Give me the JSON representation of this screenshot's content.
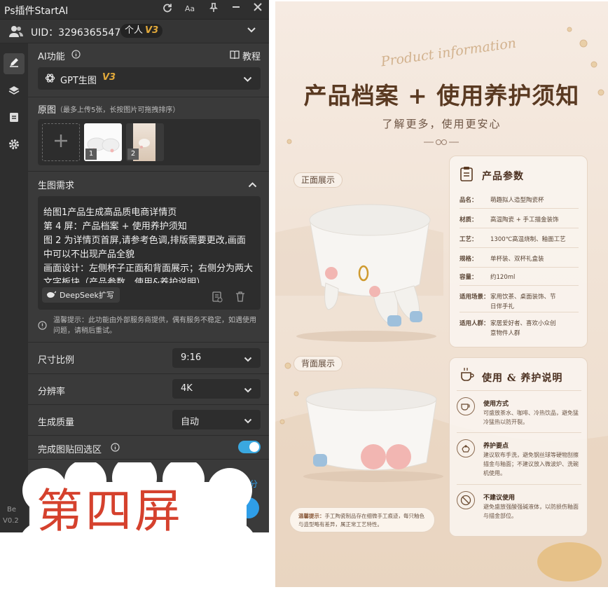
{
  "app": {
    "title": "Ps插件StartAI"
  },
  "titlebar": {
    "refresh_icon": "refresh-icon",
    "font_label": "Aa",
    "pin_icon": "pin-icon",
    "min_icon": "minimize-icon",
    "close_icon": "close-icon"
  },
  "user": {
    "uid_label": "UID：3296365547",
    "plan": "个人",
    "plan_tag": "V3"
  },
  "ai": {
    "label": "AI功能",
    "tutorial": "教程",
    "model": "GPT生图",
    "model_tag": "V3"
  },
  "source": {
    "label": "原图",
    "hint": "（最多上传5张，长按图片可拖拽排序）",
    "thumbs": [
      {
        "index": "1"
      },
      {
        "index": "2"
      }
    ]
  },
  "request": {
    "label": "生图需求",
    "text": "给图1产品生成高品质电商详情页\n第 4 屏：产品档案 + 使用养护须知\n图 2 为详情页首屏,请参考色调,排版需要更改,画面中可以不出现产品全貌\n画面设计：左侧杯子正面和背面展示；右侧分为两大文字板块（产品参数、使用&养护说明）",
    "deepseek": "DeepSeek扩写",
    "notice": "温馨提示：此功能由外部服务商提供，偶有服务不稳定，如遇使用问题，请稍后重试。"
  },
  "settings": {
    "ratio_label": "尺寸比例",
    "ratio_value": "9:16",
    "res_label": "分辨率",
    "res_value": "4K",
    "quality_label": "生成质量",
    "quality_value": "自动",
    "paste_label": "完成图贴回选区",
    "paste_on": true,
    "partial_right": "积分",
    "partial_left1": "Be",
    "partial_left2": "V0.2"
  },
  "overlay": {
    "text": "第四屏"
  },
  "poster": {
    "script": "Product  information",
    "title": "产品档案 + 使用养护须知",
    "subtitle": "了解更多，使用更安心",
    "front_label": "正面展示",
    "back_label": "背面展示",
    "params_title": "产品参数",
    "params": [
      {
        "k": "品名：",
        "v": "萌趣拟人造型陶瓷杯"
      },
      {
        "k": "材质：",
        "v": "高温陶瓷 + 手工描金装饰"
      },
      {
        "k": "工艺：",
        "v": "1300℃高温烧制、釉面工艺"
      },
      {
        "k": "规格：",
        "v": "单杯装、双杯礼盒装"
      },
      {
        "k": "容量：",
        "v": "约120ml"
      },
      {
        "k": "适用场景：",
        "v": "家用饮茶、桌面装饰、节日伴手礼"
      },
      {
        "k": "适用人群：",
        "v": "家居爱好者、喜欢小众创意物件人群"
      }
    ],
    "care_title": "使用 & 养护说明",
    "care": [
      {
        "t": "使用方式",
        "d": "可盛放茶水、咖啡、冷热饮品，避免猛冷猛热以防开裂。"
      },
      {
        "t": "养护要点",
        "d": "建议软布手洗，避免钢丝球等硬物刮擦描金与釉面；不建议放入微波炉、洗碗机使用。"
      },
      {
        "t": "不建议使用",
        "d": "避免盛放强酸强碱液体，以防损伤釉面与描金部位。"
      }
    ],
    "tip_label": "温馨提示：",
    "tip_text": "手工陶瓷制品存在细微手工痕迹，每只釉色与造型略有差异，属正常工艺特性。"
  }
}
